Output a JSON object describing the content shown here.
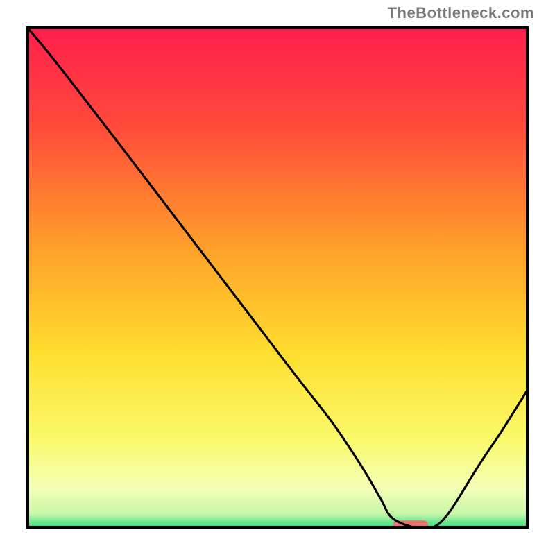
{
  "attribution": "TheBottleneck.com",
  "chart_data": {
    "type": "line",
    "title": "",
    "xlabel": "",
    "ylabel": "",
    "xlim": [
      0,
      100
    ],
    "ylim": [
      0,
      100
    ],
    "grid": false,
    "legend": false,
    "gradient_stops": [
      {
        "offset": 0,
        "color": "#ff1e4c"
      },
      {
        "offset": 20,
        "color": "#ff4b3a"
      },
      {
        "offset": 45,
        "color": "#ffa32a"
      },
      {
        "offset": 65,
        "color": "#ffde2f"
      },
      {
        "offset": 82,
        "color": "#faf96a"
      },
      {
        "offset": 92,
        "color": "#f3ffb7"
      },
      {
        "offset": 97,
        "color": "#c9f7a8"
      },
      {
        "offset": 100,
        "color": "#24db7c"
      }
    ],
    "series": [
      {
        "name": "bottleneck-curve",
        "color": "#000000",
        "x": [
          0,
          5,
          12,
          22,
          30,
          38,
          46,
          54,
          61,
          67,
          70.5,
          73,
          78,
          80.5,
          84,
          90,
          95,
          100
        ],
        "y": [
          100,
          94,
          85,
          72,
          61.5,
          51,
          40.5,
          30,
          21,
          12,
          6,
          2,
          0,
          0,
          3,
          12.5,
          20,
          28
        ]
      }
    ],
    "marker": {
      "x_start": 73,
      "x_end": 80,
      "y": 0.8,
      "color": "#e6736e"
    }
  }
}
